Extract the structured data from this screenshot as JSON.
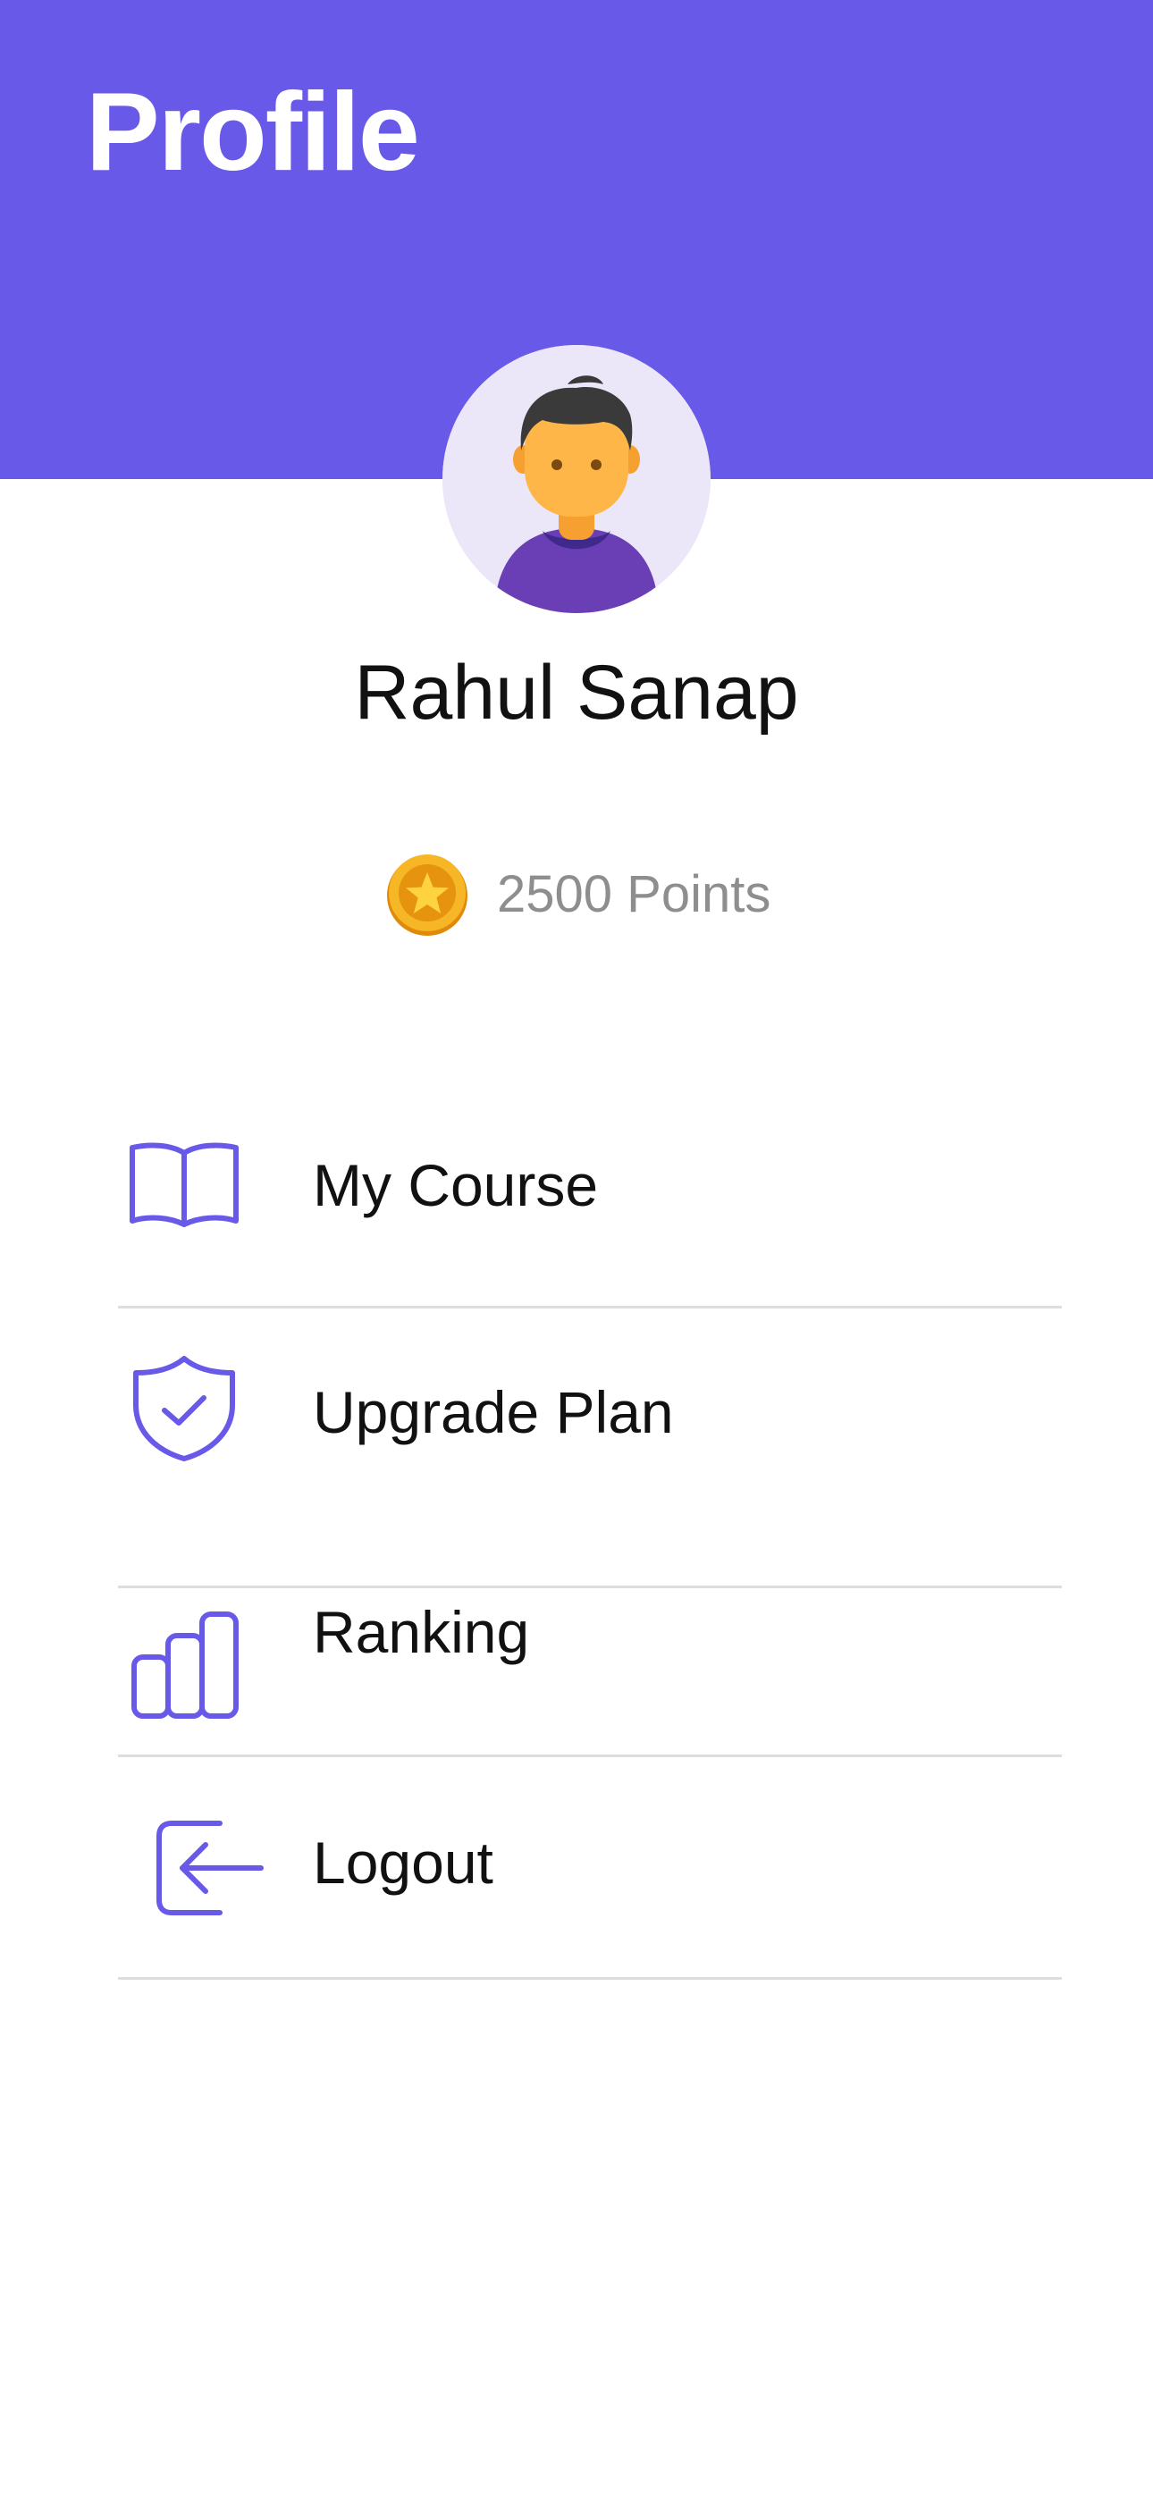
{
  "header": {
    "title": "Profile",
    "background_color": "#6859E8"
  },
  "profile": {
    "avatar_icon": "user-avatar",
    "name": "Rahul Sanap",
    "points_icon": "gold-star-coin",
    "points_label": "2500 Points"
  },
  "menu": {
    "accent_color": "#6859E8",
    "items": [
      {
        "id": "my-course",
        "label": "My Course",
        "icon": "open-book"
      },
      {
        "id": "upgrade-plan",
        "label": "Upgrade Plan",
        "icon": "shield-check"
      },
      {
        "id": "ranking",
        "label": "Ranking",
        "icon": "bar-chart"
      },
      {
        "id": "logout",
        "label": "Logout",
        "icon": "logout-arrow"
      }
    ]
  }
}
